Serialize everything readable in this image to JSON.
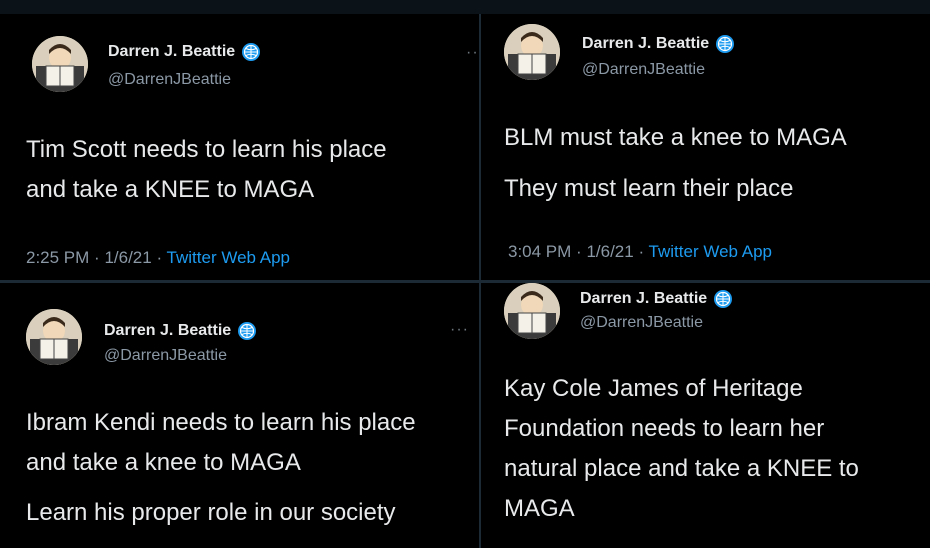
{
  "tweets": [
    {
      "author": "Darren J. Beattie",
      "handle": "@DarrenJBeattie",
      "lines": [
        "Tim Scott needs to learn his place",
        "and take a KNEE to MAGA"
      ],
      "time": "2:25 PM",
      "date": "1/6/21",
      "app": "Twitter Web App",
      "more": "··"
    },
    {
      "author": "Darren J. Beattie",
      "handle": "@DarrenJBeattie",
      "lines": [
        "BLM must take a knee to MAGA",
        "They must learn their place"
      ],
      "time": "3:04 PM",
      "date": "1/6/21",
      "app": "Twitter Web App"
    },
    {
      "author": "Darren J. Beattie",
      "handle": "@DarrenJBeattie",
      "lines": [
        "Ibram Kendi needs to learn his place",
        "and take a knee to MAGA",
        "Learn his proper role in our society"
      ],
      "more": "···"
    },
    {
      "author": "Darren J. Beattie",
      "handle": "@DarrenJBeattie",
      "lines": [
        "Kay Cole James of Heritage",
        "Foundation needs to learn her",
        "natural place and take a KNEE to",
        "MAGA"
      ]
    }
  ],
  "separator": "·",
  "icons": {
    "verified": "verified-badge-icon",
    "more": "more-options-icon"
  },
  "colors": {
    "background": "#000000",
    "text": "#e7e9ea",
    "muted": "#8b98a5",
    "link": "#1d9bf0",
    "verified": "#1d9bf0"
  }
}
